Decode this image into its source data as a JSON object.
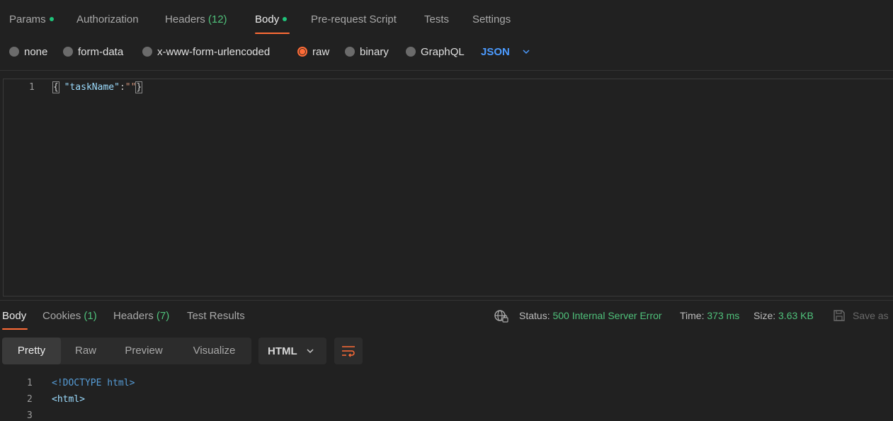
{
  "request_tabs": [
    {
      "label": "Params",
      "has_dot": true
    },
    {
      "label": "Authorization"
    },
    {
      "label": "Headers",
      "count": "(12)"
    },
    {
      "label": "Body",
      "has_dot": true,
      "active": true
    },
    {
      "label": "Pre-request Script"
    },
    {
      "label": "Tests"
    },
    {
      "label": "Settings"
    }
  ],
  "body_types": {
    "options": [
      "none",
      "form-data",
      "x-www-form-urlencoded",
      "raw",
      "binary",
      "GraphQL"
    ],
    "selected": "raw",
    "language": "JSON"
  },
  "request_editor": {
    "lines": [
      {
        "number": "1",
        "open": "{",
        "key": "\"taskName\"",
        "colon": ":",
        "value": "\"\"",
        "close": "}"
      }
    ]
  },
  "response": {
    "tabs": [
      {
        "label": "Body",
        "active": true
      },
      {
        "label": "Cookies",
        "count": "(1)"
      },
      {
        "label": "Headers",
        "count": "(7)"
      },
      {
        "label": "Test Results"
      }
    ],
    "status_label": "Status:",
    "status_value": "500 Internal Server Error",
    "time_label": "Time:",
    "time_value": "373 ms",
    "size_label": "Size:",
    "size_value": "3.63 KB",
    "save_as": "Save as",
    "views": [
      "Pretty",
      "Raw",
      "Preview",
      "Visualize"
    ],
    "active_view": "Pretty",
    "format": "HTML",
    "lines": [
      {
        "number": "1",
        "text": "<!DOCTYPE html>"
      },
      {
        "number": "2",
        "text": "<html>"
      },
      {
        "number": "3",
        "text": ""
      }
    ]
  },
  "colors": {
    "accent": "#ff6c37",
    "success": "#1fc37a",
    "link": "#4c9bff",
    "background": "#212121"
  },
  "icons": [
    "globe-lock-icon",
    "save-icon",
    "chevron-down-icon",
    "wrap-lines-icon"
  ]
}
